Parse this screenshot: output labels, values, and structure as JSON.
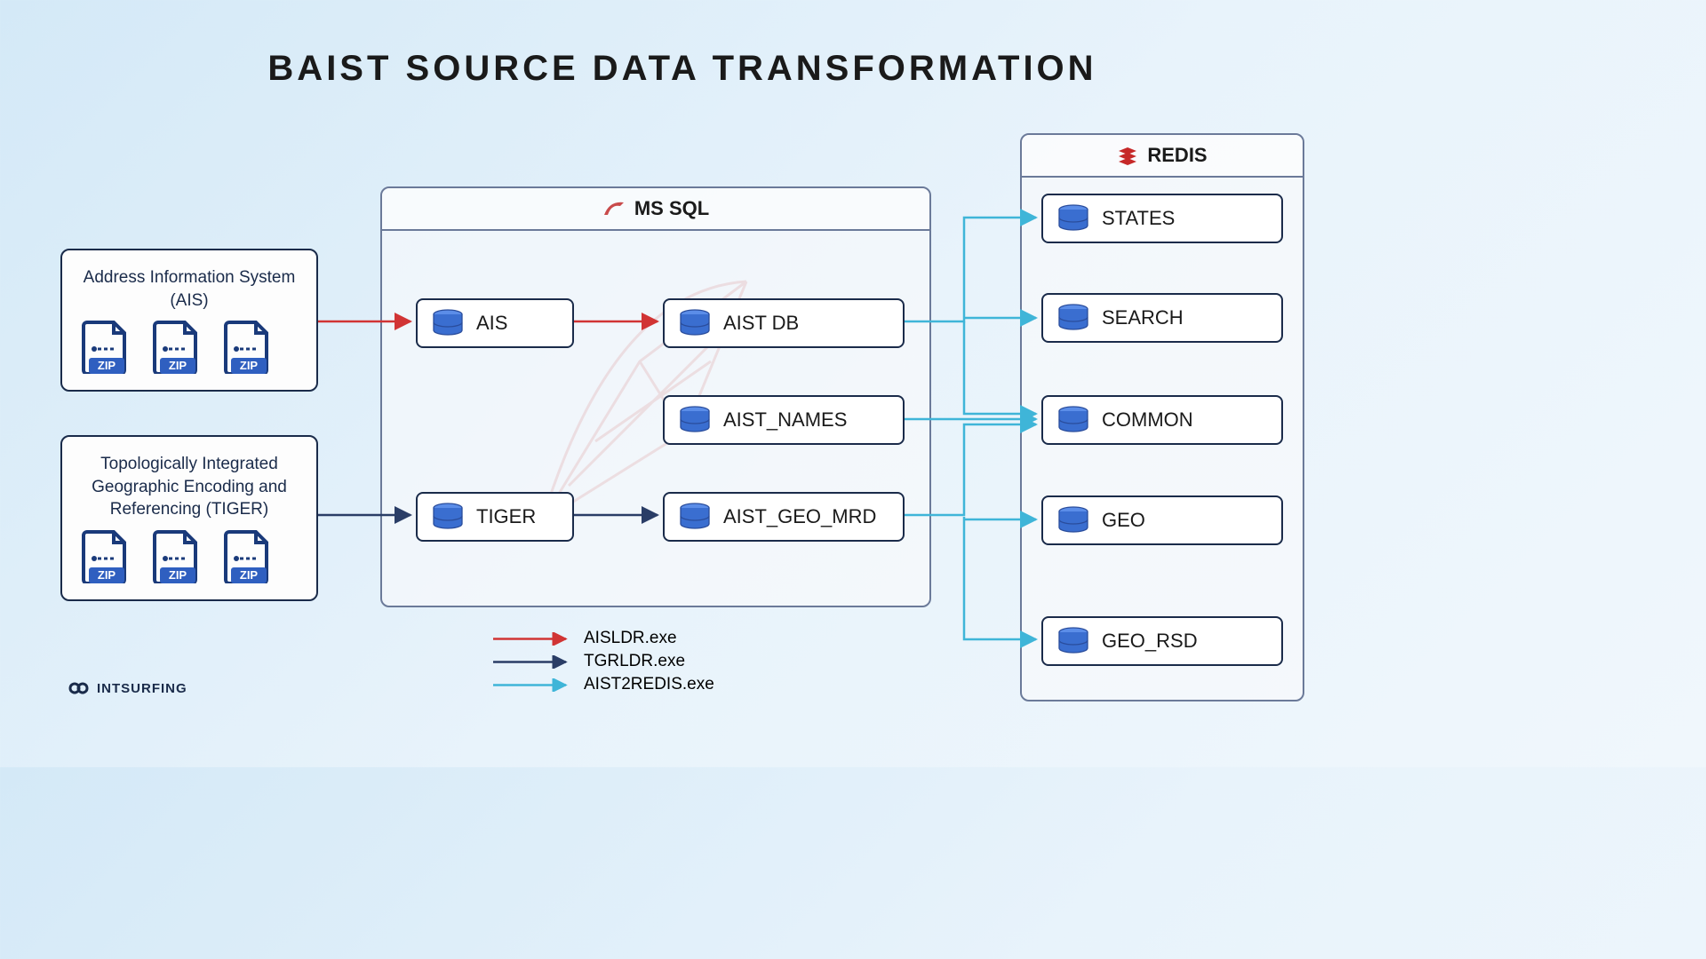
{
  "title": "BAIST SOURCE DATA TRANSFORMATION",
  "sources": {
    "ais": {
      "label": "Address Information System (AIS)"
    },
    "tiger": {
      "label": "Topologically Integrated Geographic Encoding and Referencing (TIGER)"
    }
  },
  "mssql": {
    "title": "MS SQL",
    "nodes": {
      "ais": "AIS",
      "tiger": "TIGER",
      "aist_db": "AIST DB",
      "aist_names": "AIST_NAMES",
      "aist_geo_mrd": "AIST_GEO_MRD"
    }
  },
  "redis": {
    "title": "REDIS",
    "nodes": {
      "states": "STATES",
      "search": "SEARCH",
      "common": "COMMON",
      "geo": "GEO",
      "geo_rsd": "GEO_RSD"
    }
  },
  "legend": {
    "aisldr": "AISLDR.exe",
    "tgrldr": "TGRLDR.exe",
    "aist2redis": "AIST2REDIS.exe"
  },
  "brand": "INTSURFING",
  "colors": {
    "red": "#d13434",
    "navy": "#2a3d66",
    "cyan": "#3fb5d8",
    "db_blue": "#3060c0"
  }
}
